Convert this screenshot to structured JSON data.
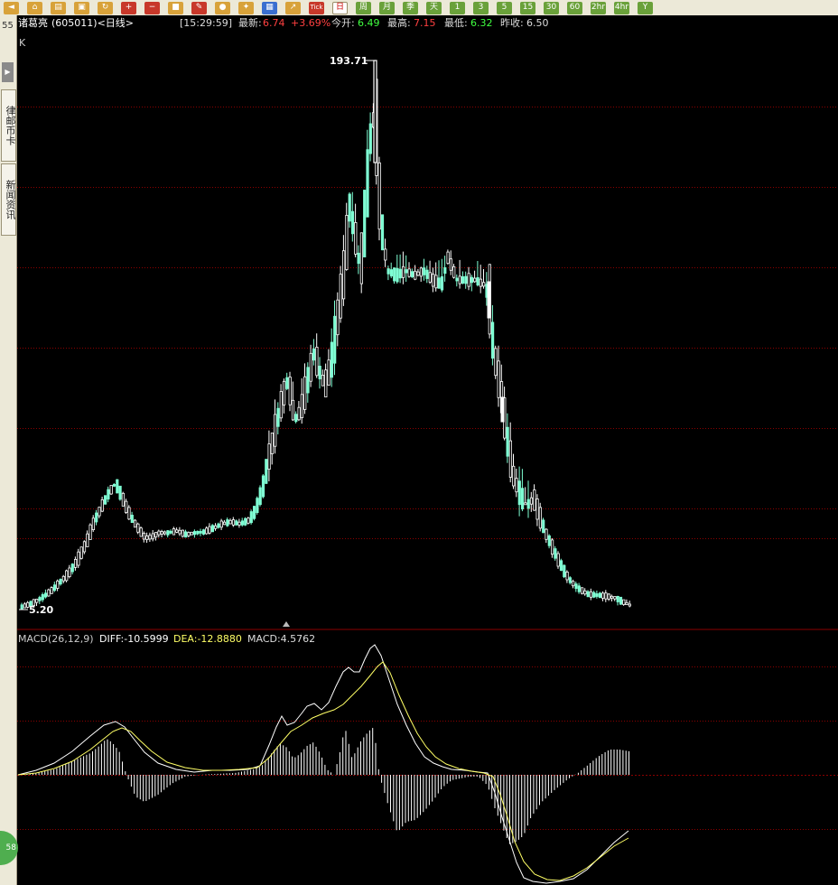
{
  "toolbar": {
    "buttons": [
      {
        "icon": "back-arrow-icon"
      },
      {
        "icon": "home-icon"
      },
      {
        "icon": "database-icon"
      },
      {
        "icon": "book-icon"
      },
      {
        "icon": "refresh-icon"
      },
      {
        "icon": "zoom-in-icon"
      },
      {
        "icon": "zoom-out-icon"
      },
      {
        "icon": "blocks-icon"
      },
      {
        "icon": "pencil-icon"
      },
      {
        "icon": "paint-icon"
      },
      {
        "icon": "pin-icon"
      },
      {
        "icon": "table-icon"
      },
      {
        "icon": "trend-chart-icon"
      }
    ],
    "tick_label": "Tick",
    "periods": [
      "日",
      "周",
      "月",
      "季",
      "天",
      "1",
      "3",
      "5",
      "15",
      "30",
      "60",
      "2hr",
      "4hr",
      "Y"
    ],
    "active_period": "日"
  },
  "sidebar": {
    "number": "55",
    "tabs": [
      "律邮币卡",
      "新闻资讯"
    ],
    "bottom_badge": "58"
  },
  "info_bar": {
    "stock_name": "诸葛亮",
    "code_period": "(605011)<日线>",
    "time": "[15:29:59]",
    "latest_label": "最新:",
    "latest_value": "6.74",
    "change_pct": "+3.69%",
    "open_label": "今开:",
    "open_value": "6.49",
    "high_label": "最高:",
    "high_value": "7.15",
    "low_label": "最低:",
    "low_value": "6.32",
    "prev_close_label": "昨收:",
    "prev_close_value": "6.50"
  },
  "kline": {
    "panel_label": "K",
    "max_label": "193.71",
    "min_label": "5.20"
  },
  "macd": {
    "params_label": "MACD(26,12,9)",
    "diff_label": "DIFF:-10.5999",
    "dea_label": "DEA:-12.8880",
    "macd_label": "MACD:4.5762"
  },
  "colors": {
    "background": "#000000",
    "grid": "#8b0000",
    "up_candle": "#ffffff",
    "down_candle": "#7fffd4",
    "diff_line": "#ffffff",
    "dea_line": "#ffff66",
    "price_up": "#ff4040",
    "price_down": "#40ff40"
  }
}
